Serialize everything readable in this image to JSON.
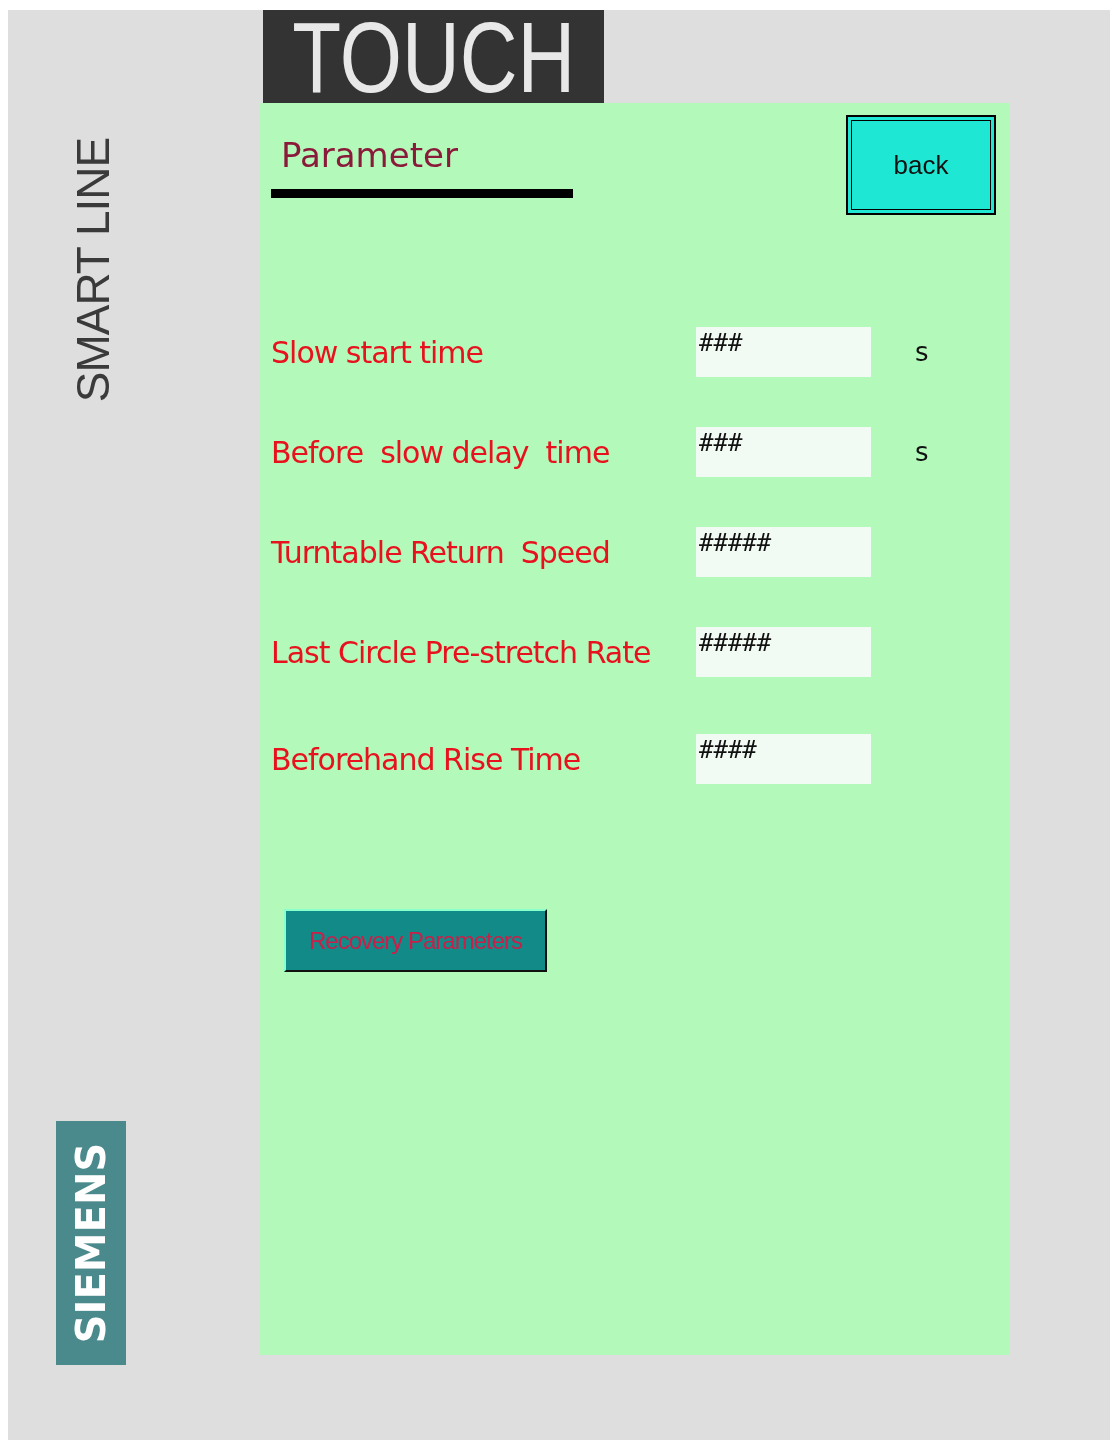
{
  "bezel": {
    "series": "SMART LINE",
    "brand": "SIEMENS"
  },
  "header": {
    "title": "TOUCH"
  },
  "screen": {
    "title": "Parameter",
    "back_button": "back",
    "parameters": [
      {
        "label": "Slow start time",
        "value": "###",
        "unit": "s"
      },
      {
        "label": "Before  slow delay  time",
        "value": "###",
        "unit": "s"
      },
      {
        "label": "Turntable Return  Speed",
        "value": "#####"
      },
      {
        "label": "Last Circle Pre-stretch Rate",
        "value": "#####"
      },
      {
        "label": "Beforehand Rise Time",
        "value": "####"
      }
    ],
    "recovery_button": "Recovery Parameters"
  }
}
